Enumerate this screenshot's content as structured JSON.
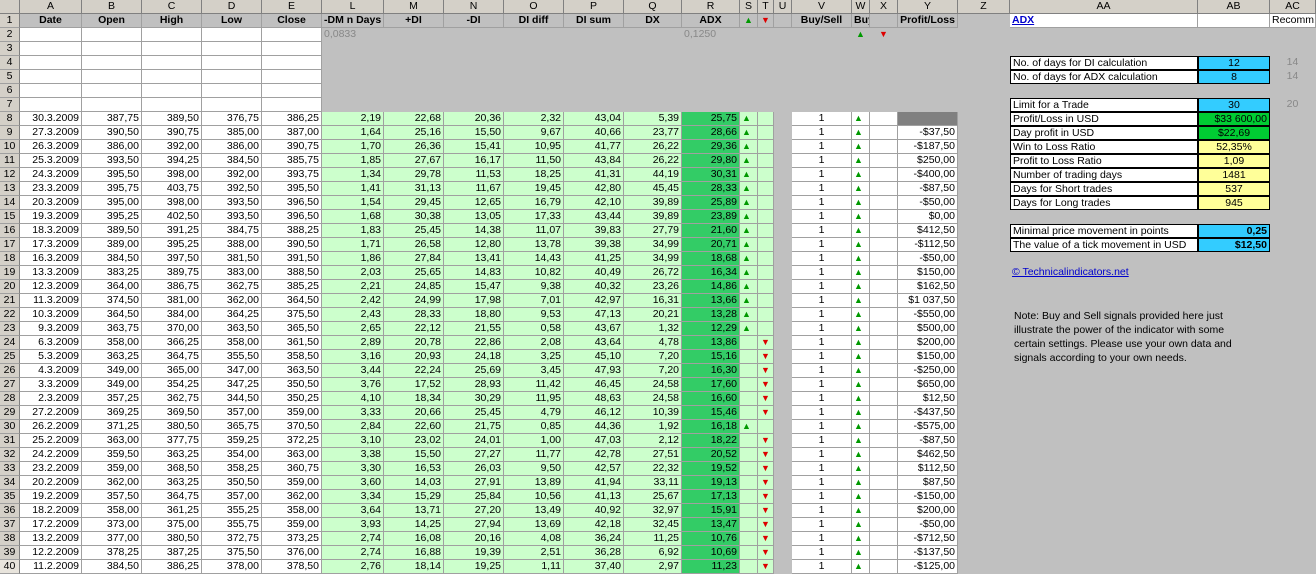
{
  "columns": [
    "A",
    "B",
    "C",
    "D",
    "E",
    "L",
    "M",
    "N",
    "O",
    "P",
    "Q",
    "R",
    "S",
    "T",
    "U",
    "V",
    "W",
    "X",
    "Y",
    "Z",
    "AA",
    "AB",
    "AC"
  ],
  "header_row": [
    "Date",
    "Open",
    "High",
    "Low",
    "Close",
    "-DM n Days",
    "+DI",
    "-DI",
    "DI diff",
    "DI sum",
    "DX",
    "ADX",
    "▲",
    "▼",
    "",
    "Buy/Sell",
    "Buy/Sell",
    "",
    "Profit/Loss"
  ],
  "row2": {
    "L": "0,0833",
    "R": "0,1250"
  },
  "rows": [
    [
      "30.3.2009",
      "387,75",
      "389,50",
      "376,75",
      "386,25",
      "2,19",
      "22,68",
      "20,36",
      "2,32",
      "43,04",
      "5,39",
      "25,75",
      "▲",
      "",
      "1",
      "▲",
      ""
    ],
    [
      "27.3.2009",
      "390,50",
      "390,75",
      "385,00",
      "387,00",
      "1,64",
      "25,16",
      "15,50",
      "9,67",
      "40,66",
      "23,77",
      "28,66",
      "▲",
      "",
      "1",
      "▲",
      "-$37,50"
    ],
    [
      "26.3.2009",
      "386,00",
      "392,00",
      "386,00",
      "390,75",
      "1,70",
      "26,36",
      "15,41",
      "10,95",
      "41,77",
      "26,22",
      "29,36",
      "▲",
      "",
      "1",
      "▲",
      "-$187,50"
    ],
    [
      "25.3.2009",
      "393,50",
      "394,25",
      "384,50",
      "385,75",
      "1,85",
      "27,67",
      "16,17",
      "11,50",
      "43,84",
      "26,22",
      "29,80",
      "▲",
      "",
      "1",
      "▲",
      "$250,00"
    ],
    [
      "24.3.2009",
      "395,50",
      "398,00",
      "392,00",
      "393,75",
      "1,34",
      "29,78",
      "11,53",
      "18,25",
      "41,31",
      "44,19",
      "30,31",
      "▲",
      "",
      "1",
      "▲",
      "-$400,00"
    ],
    [
      "23.3.2009",
      "395,75",
      "403,75",
      "392,50",
      "395,50",
      "1,41",
      "31,13",
      "11,67",
      "19,45",
      "42,80",
      "45,45",
      "28,33",
      "▲",
      "",
      "1",
      "▲",
      "-$87,50"
    ],
    [
      "20.3.2009",
      "395,00",
      "398,00",
      "393,50",
      "396,50",
      "1,54",
      "29,45",
      "12,65",
      "16,79",
      "42,10",
      "39,89",
      "25,89",
      "▲",
      "",
      "1",
      "▲",
      "-$50,00"
    ],
    [
      "19.3.2009",
      "395,25",
      "402,50",
      "393,50",
      "396,50",
      "1,68",
      "30,38",
      "13,05",
      "17,33",
      "43,44",
      "39,89",
      "23,89",
      "▲",
      "",
      "1",
      "▲",
      "$0,00"
    ],
    [
      "18.3.2009",
      "389,50",
      "391,25",
      "384,75",
      "388,25",
      "1,83",
      "25,45",
      "14,38",
      "11,07",
      "39,83",
      "27,79",
      "21,60",
      "▲",
      "",
      "1",
      "▲",
      "$412,50"
    ],
    [
      "17.3.2009",
      "389,00",
      "395,25",
      "388,00",
      "390,50",
      "1,71",
      "26,58",
      "12,80",
      "13,78",
      "39,38",
      "34,99",
      "20,71",
      "▲",
      "",
      "1",
      "▲",
      "-$112,50"
    ],
    [
      "16.3.2009",
      "384,50",
      "397,50",
      "381,50",
      "391,50",
      "1,86",
      "27,84",
      "13,41",
      "14,43",
      "41,25",
      "34,99",
      "18,68",
      "▲",
      "",
      "1",
      "▲",
      "-$50,00"
    ],
    [
      "13.3.2009",
      "383,25",
      "389,75",
      "383,00",
      "388,50",
      "2,03",
      "25,65",
      "14,83",
      "10,82",
      "40,49",
      "26,72",
      "16,34",
      "▲",
      "",
      "1",
      "▲",
      "$150,00"
    ],
    [
      "12.3.2009",
      "364,00",
      "386,75",
      "362,75",
      "385,25",
      "2,21",
      "24,85",
      "15,47",
      "9,38",
      "40,32",
      "23,26",
      "14,86",
      "▲",
      "",
      "1",
      "▲",
      "$162,50"
    ],
    [
      "11.3.2009",
      "374,50",
      "381,00",
      "362,00",
      "364,50",
      "2,42",
      "24,99",
      "17,98",
      "7,01",
      "42,97",
      "16,31",
      "13,66",
      "▲",
      "",
      "1",
      "▲",
      "$1 037,50"
    ],
    [
      "10.3.2009",
      "364,50",
      "384,00",
      "364,25",
      "375,50",
      "2,43",
      "28,33",
      "18,80",
      "9,53",
      "47,13",
      "20,21",
      "13,28",
      "▲",
      "",
      "1",
      "▲",
      "-$550,00"
    ],
    [
      "9.3.2009",
      "363,75",
      "370,00",
      "363,50",
      "365,50",
      "2,65",
      "22,12",
      "21,55",
      "0,58",
      "43,67",
      "1,32",
      "12,29",
      "▲",
      "",
      "1",
      "▲",
      "$500,00"
    ],
    [
      "6.3.2009",
      "358,00",
      "366,25",
      "358,00",
      "361,50",
      "2,89",
      "20,78",
      "22,86",
      "2,08",
      "43,64",
      "4,78",
      "13,86",
      "",
      "▼",
      "1",
      "▲",
      "$200,00"
    ],
    [
      "5.3.2009",
      "363,25",
      "364,75",
      "355,50",
      "358,50",
      "3,16",
      "20,93",
      "24,18",
      "3,25",
      "45,10",
      "7,20",
      "15,16",
      "",
      "▼",
      "1",
      "▲",
      "$150,00"
    ],
    [
      "4.3.2009",
      "349,00",
      "365,00",
      "347,00",
      "363,50",
      "3,44",
      "22,24",
      "25,69",
      "3,45",
      "47,93",
      "7,20",
      "16,30",
      "",
      "▼",
      "1",
      "▲",
      "-$250,00"
    ],
    [
      "3.3.2009",
      "349,00",
      "354,25",
      "347,25",
      "350,50",
      "3,76",
      "17,52",
      "28,93",
      "11,42",
      "46,45",
      "24,58",
      "17,60",
      "",
      "▼",
      "1",
      "▲",
      "$650,00"
    ],
    [
      "2.3.2009",
      "357,25",
      "362,75",
      "344,50",
      "350,25",
      "4,10",
      "18,34",
      "30,29",
      "11,95",
      "48,63",
      "24,58",
      "16,60",
      "",
      "▼",
      "1",
      "▲",
      "$12,50"
    ],
    [
      "27.2.2009",
      "369,25",
      "369,50",
      "357,00",
      "359,00",
      "3,33",
      "20,66",
      "25,45",
      "4,79",
      "46,12",
      "10,39",
      "15,46",
      "",
      "▼",
      "1",
      "▲",
      "-$437,50"
    ],
    [
      "26.2.2009",
      "371,25",
      "380,50",
      "365,75",
      "370,50",
      "2,84",
      "22,60",
      "21,75",
      "0,85",
      "44,36",
      "1,92",
      "16,18",
      "▲",
      "",
      "1",
      "▲",
      "-$575,00"
    ],
    [
      "25.2.2009",
      "363,00",
      "377,75",
      "359,25",
      "372,25",
      "3,10",
      "23,02",
      "24,01",
      "1,00",
      "47,03",
      "2,12",
      "18,22",
      "",
      "▼",
      "1",
      "▲",
      "-$87,50"
    ],
    [
      "24.2.2009",
      "359,50",
      "363,25",
      "354,00",
      "363,00",
      "3,38",
      "15,50",
      "27,27",
      "11,77",
      "42,78",
      "27,51",
      "20,52",
      "",
      "▼",
      "1",
      "▲",
      "$462,50"
    ],
    [
      "23.2.2009",
      "359,00",
      "368,50",
      "358,25",
      "360,75",
      "3,30",
      "16,53",
      "26,03",
      "9,50",
      "42,57",
      "22,32",
      "19,52",
      "",
      "▼",
      "1",
      "▲",
      "$112,50"
    ],
    [
      "20.2.2009",
      "362,00",
      "363,25",
      "350,50",
      "359,00",
      "3,60",
      "14,03",
      "27,91",
      "13,89",
      "41,94",
      "33,11",
      "19,13",
      "",
      "▼",
      "1",
      "▲",
      "$87,50"
    ],
    [
      "19.2.2009",
      "357,50",
      "364,75",
      "357,00",
      "362,00",
      "3,34",
      "15,29",
      "25,84",
      "10,56",
      "41,13",
      "25,67",
      "17,13",
      "",
      "▼",
      "1",
      "▲",
      "-$150,00"
    ],
    [
      "18.2.2009",
      "358,00",
      "361,25",
      "355,25",
      "358,00",
      "3,64",
      "13,71",
      "27,20",
      "13,49",
      "40,92",
      "32,97",
      "15,91",
      "",
      "▼",
      "1",
      "▲",
      "$200,00"
    ],
    [
      "17.2.2009",
      "373,00",
      "375,00",
      "355,75",
      "359,00",
      "3,93",
      "14,25",
      "27,94",
      "13,69",
      "42,18",
      "32,45",
      "13,47",
      "",
      "▼",
      "1",
      "▲",
      "-$50,00"
    ],
    [
      "13.2.2009",
      "377,00",
      "380,50",
      "372,75",
      "373,25",
      "2,74",
      "16,08",
      "20,16",
      "4,08",
      "36,24",
      "11,25",
      "10,76",
      "",
      "▼",
      "1",
      "▲",
      "-$712,50"
    ],
    [
      "12.2.2009",
      "378,25",
      "387,25",
      "375,50",
      "376,00",
      "2,74",
      "16,88",
      "19,39",
      "2,51",
      "36,28",
      "6,92",
      "10,69",
      "",
      "▼",
      "1",
      "▲",
      "-$137,50"
    ],
    [
      "11.2.2009",
      "384,50",
      "386,25",
      "378,00",
      "378,50",
      "2,76",
      "18,14",
      "19,25",
      "1,11",
      "37,40",
      "2,97",
      "11,23",
      "",
      "▼",
      "1",
      "▲",
      "-$125,00"
    ]
  ],
  "panel": {
    "title": "ADX",
    "recomm": "Recomm.",
    "di_days_label": "No. of days for DI calculation",
    "di_days": "12",
    "di_days_ac": "14",
    "adx_days_label": "No. of days for ADX calculation",
    "adx_days": "8",
    "adx_days_ac": "14",
    "limit_label": "Limit for a Trade",
    "limit": "30",
    "limit_ac": "20",
    "pl_label": "Profit/Loss in USD",
    "pl": "$33 600,00",
    "day_label": "Day profit in USD",
    "day": "$22,69",
    "wl_label": "Win to Loss Ratio",
    "wl": "52,35%",
    "pr_label": "Profit to Loss Ratio",
    "pr": "1,09",
    "trading_label": "Number of trading days",
    "trading": "1481",
    "short_label": "Days for Short trades",
    "short": "537",
    "long_label": "Days for Long trades",
    "long": "945",
    "minmove_label": "Minimal price movement in points",
    "minmove": "0,25",
    "tick_label": "The value of a tick movement in USD",
    "tick": "$12,50",
    "copyright": "© Technicalindicators.net",
    "note": "Note: Buy and Sell signals provided here just illustrate the power of the indicator with some certain settings. Please use your own data and signals according to your own needs."
  },
  "row2_signals": {
    "W": "▲",
    "X": "▼"
  }
}
